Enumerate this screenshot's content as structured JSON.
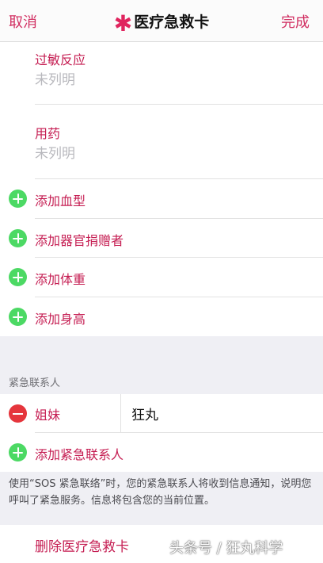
{
  "navbar": {
    "cancel": "取消",
    "title": "医疗急救卡",
    "done": "完成"
  },
  "fields": [
    {
      "label": "过敏反应",
      "value": "未列明"
    },
    {
      "label": "用药",
      "value": "未列明"
    }
  ],
  "add_items": [
    "添加血型",
    "添加器官捐赠者",
    "添加体重",
    "添加身高"
  ],
  "emergency": {
    "header": "紧急联系人",
    "contact": {
      "relation": "姐妹",
      "name": "狂丸"
    },
    "add_label": "添加紧急联系人",
    "note": "使用“SOS 紧急联络”时，您的紧急联系人将收到信息通知，说明您呼叫了紧急服务。信息将包含您的当前位置。"
  },
  "delete_label": "删除医疗急救卡",
  "watermark": "头条号 / 狂丸科学",
  "colors": {
    "accent": "#c51d52",
    "add": "#4cd964",
    "remove": "#e5353c",
    "background": "#efeff4"
  }
}
